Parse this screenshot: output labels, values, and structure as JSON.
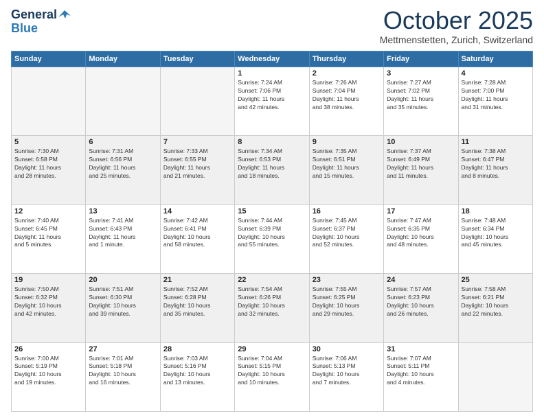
{
  "header": {
    "logo_general": "General",
    "logo_blue": "Blue",
    "month": "October 2025",
    "location": "Mettmenstetten, Zurich, Switzerland"
  },
  "days_of_week": [
    "Sunday",
    "Monday",
    "Tuesday",
    "Wednesday",
    "Thursday",
    "Friday",
    "Saturday"
  ],
  "weeks": [
    [
      {
        "day": "",
        "info": ""
      },
      {
        "day": "",
        "info": ""
      },
      {
        "day": "",
        "info": ""
      },
      {
        "day": "1",
        "info": "Sunrise: 7:24 AM\nSunset: 7:06 PM\nDaylight: 11 hours\nand 42 minutes."
      },
      {
        "day": "2",
        "info": "Sunrise: 7:26 AM\nSunset: 7:04 PM\nDaylight: 11 hours\nand 38 minutes."
      },
      {
        "day": "3",
        "info": "Sunrise: 7:27 AM\nSunset: 7:02 PM\nDaylight: 11 hours\nand 35 minutes."
      },
      {
        "day": "4",
        "info": "Sunrise: 7:28 AM\nSunset: 7:00 PM\nDaylight: 11 hours\nand 31 minutes."
      }
    ],
    [
      {
        "day": "5",
        "info": "Sunrise: 7:30 AM\nSunset: 6:58 PM\nDaylight: 11 hours\nand 28 minutes."
      },
      {
        "day": "6",
        "info": "Sunrise: 7:31 AM\nSunset: 6:56 PM\nDaylight: 11 hours\nand 25 minutes."
      },
      {
        "day": "7",
        "info": "Sunrise: 7:33 AM\nSunset: 6:55 PM\nDaylight: 11 hours\nand 21 minutes."
      },
      {
        "day": "8",
        "info": "Sunrise: 7:34 AM\nSunset: 6:53 PM\nDaylight: 11 hours\nand 18 minutes."
      },
      {
        "day": "9",
        "info": "Sunrise: 7:35 AM\nSunset: 6:51 PM\nDaylight: 11 hours\nand 15 minutes."
      },
      {
        "day": "10",
        "info": "Sunrise: 7:37 AM\nSunset: 6:49 PM\nDaylight: 11 hours\nand 11 minutes."
      },
      {
        "day": "11",
        "info": "Sunrise: 7:38 AM\nSunset: 6:47 PM\nDaylight: 11 hours\nand 8 minutes."
      }
    ],
    [
      {
        "day": "12",
        "info": "Sunrise: 7:40 AM\nSunset: 6:45 PM\nDaylight: 11 hours\nand 5 minutes."
      },
      {
        "day": "13",
        "info": "Sunrise: 7:41 AM\nSunset: 6:43 PM\nDaylight: 11 hours\nand 1 minute."
      },
      {
        "day": "14",
        "info": "Sunrise: 7:42 AM\nSunset: 6:41 PM\nDaylight: 10 hours\nand 58 minutes."
      },
      {
        "day": "15",
        "info": "Sunrise: 7:44 AM\nSunset: 6:39 PM\nDaylight: 10 hours\nand 55 minutes."
      },
      {
        "day": "16",
        "info": "Sunrise: 7:45 AM\nSunset: 6:37 PM\nDaylight: 10 hours\nand 52 minutes."
      },
      {
        "day": "17",
        "info": "Sunrise: 7:47 AM\nSunset: 6:35 PM\nDaylight: 10 hours\nand 48 minutes."
      },
      {
        "day": "18",
        "info": "Sunrise: 7:48 AM\nSunset: 6:34 PM\nDaylight: 10 hours\nand 45 minutes."
      }
    ],
    [
      {
        "day": "19",
        "info": "Sunrise: 7:50 AM\nSunset: 6:32 PM\nDaylight: 10 hours\nand 42 minutes."
      },
      {
        "day": "20",
        "info": "Sunrise: 7:51 AM\nSunset: 6:30 PM\nDaylight: 10 hours\nand 39 minutes."
      },
      {
        "day": "21",
        "info": "Sunrise: 7:52 AM\nSunset: 6:28 PM\nDaylight: 10 hours\nand 35 minutes."
      },
      {
        "day": "22",
        "info": "Sunrise: 7:54 AM\nSunset: 6:26 PM\nDaylight: 10 hours\nand 32 minutes."
      },
      {
        "day": "23",
        "info": "Sunrise: 7:55 AM\nSunset: 6:25 PM\nDaylight: 10 hours\nand 29 minutes."
      },
      {
        "day": "24",
        "info": "Sunrise: 7:57 AM\nSunset: 6:23 PM\nDaylight: 10 hours\nand 26 minutes."
      },
      {
        "day": "25",
        "info": "Sunrise: 7:58 AM\nSunset: 6:21 PM\nDaylight: 10 hours\nand 22 minutes."
      }
    ],
    [
      {
        "day": "26",
        "info": "Sunrise: 7:00 AM\nSunset: 5:19 PM\nDaylight: 10 hours\nand 19 minutes."
      },
      {
        "day": "27",
        "info": "Sunrise: 7:01 AM\nSunset: 5:18 PM\nDaylight: 10 hours\nand 16 minutes."
      },
      {
        "day": "28",
        "info": "Sunrise: 7:03 AM\nSunset: 5:16 PM\nDaylight: 10 hours\nand 13 minutes."
      },
      {
        "day": "29",
        "info": "Sunrise: 7:04 AM\nSunset: 5:15 PM\nDaylight: 10 hours\nand 10 minutes."
      },
      {
        "day": "30",
        "info": "Sunrise: 7:06 AM\nSunset: 5:13 PM\nDaylight: 10 hours\nand 7 minutes."
      },
      {
        "day": "31",
        "info": "Sunrise: 7:07 AM\nSunset: 5:11 PM\nDaylight: 10 hours\nand 4 minutes."
      },
      {
        "day": "",
        "info": ""
      }
    ]
  ]
}
